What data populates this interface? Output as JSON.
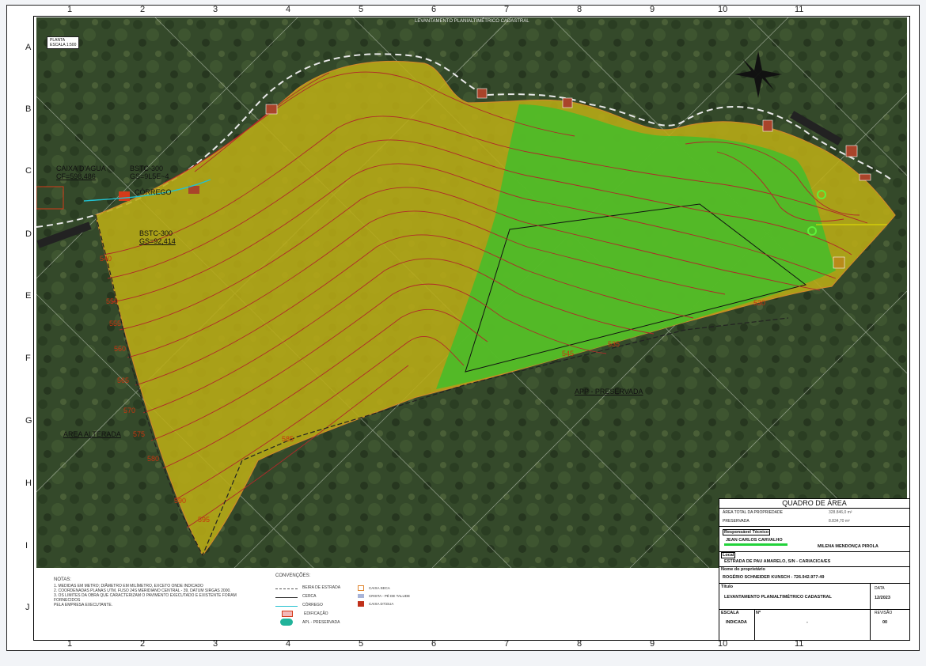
{
  "drawing_title": "LEVANTAMENTO PLANIALTIMÉTRICO CADASTRAL",
  "planta_box": {
    "line1": "PLANTA",
    "line2": "ESCALA 1:500"
  },
  "grid_columns": [
    "1",
    "2",
    "3",
    "4",
    "5",
    "6",
    "7",
    "8",
    "9",
    "10",
    "11"
  ],
  "grid_rows": [
    "A",
    "B",
    "C",
    "D",
    "E",
    "F",
    "G",
    "H",
    "I",
    "J"
  ],
  "map_labels": {
    "caixa_agua_1": "CAIXA D'AGUA",
    "caixa_agua_2": "CF=598,486",
    "bstc_top_1": "BSTC-300",
    "bstc_top_2": "GS=9L5E~4",
    "corrego": "CÓRREGO",
    "bstc_bot_1": "BSTC-300",
    "bstc_bot_2": "GS=92,414",
    "area_alterada": "AREA ALTERADA",
    "app_preservada": "APP - PRESERVADA"
  },
  "elevations": [
    "540",
    "550",
    "555",
    "560",
    "565",
    "570",
    "575",
    "580",
    "590",
    "595",
    "585",
    "545",
    "535",
    "530"
  ],
  "notes": {
    "heading": "NOTAS:",
    "items": [
      "1.   MEDIDAS EM METRO; DIÂMETRO EM MILÍMETRO, EXCETO ONDE INDICADO",
      "2.   COORDENADAS PLANAS UTM, FUSO 24S MERIDIANO CENTRAL - 39, DATUM SIRGAS 2000.",
      "3.   OS LIMITES DA OBRA QUE CARACTERIZAM O PAVIMENTO EXECUTADO E EXISTENTE FORAM FORNECIDOS",
      "      PELA EMPRESA EXECUTANTE."
    ]
  },
  "conventions": {
    "heading": "CONVENÇÕES:",
    "left": [
      "BEIRA DE ESTRADA",
      "CERCA",
      "CÓRREGO",
      "EDIFICAÇÃO",
      "APL - PRESERVADA"
    ],
    "right": [
      "CAIXA SECA",
      "CRISTA - PÉ DE TALUDE",
      "CAIXA D'ÁGUA"
    ]
  },
  "title_block": {
    "quadro": "QUADRO DE ÁREA",
    "area_total_label": "ÁREA TOTAL DA PROPRIEDADE",
    "preservada_label": "PRESERVADA",
    "area_total_value": "328.846,0 m²",
    "preservada_value": "8.834,70 m²",
    "resp_label": "Responsável Técnico",
    "resp_name": "JEAN CARLOS CARVALHO",
    "cliente": "MILENA MENDONÇA PIROLA",
    "local_label": "Local",
    "local_value": "ESTRADA DE PAU AMARELO, S/N - CARIACICA/ES",
    "proprietario_label": "Nome do proprietário",
    "proprietario_value": "ROGÉRIO SCHNEIDER KUNSCH - 726.942.977-49",
    "titulo_label": "Título",
    "titulo_value": "LEVANTAMENTO PLANIALTIMÉTRICO CADASTRAL",
    "data_label": "DATA",
    "data_value": "12/2023",
    "escala_label": "ESCALA",
    "escala_value": "INDICADA",
    "numero_label": "Nº",
    "numero_value": "-",
    "revisao_label": "REVISÃO",
    "revisao_value": "00"
  },
  "colors": {
    "altered": "#b9ac16",
    "preserved": "#44bd2a",
    "contour": "#b0282a",
    "road": "#e0832b"
  }
}
